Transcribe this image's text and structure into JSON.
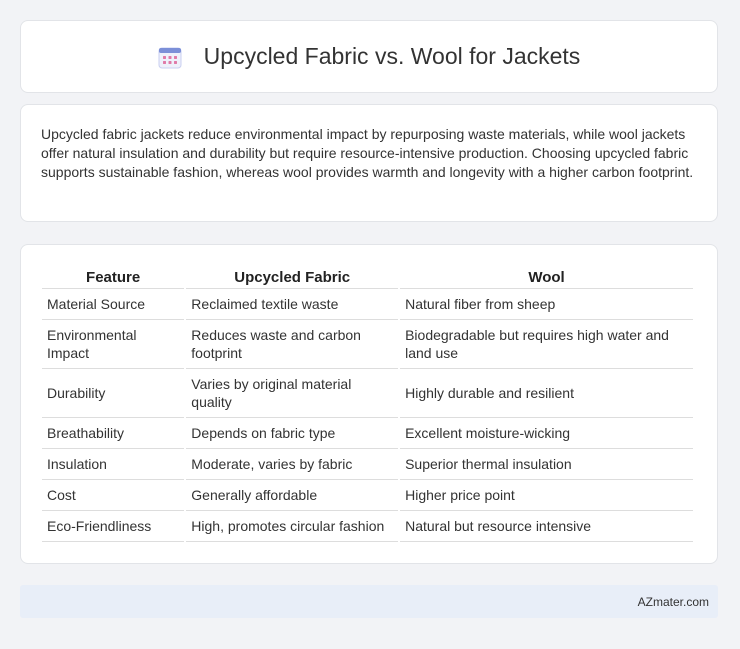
{
  "header": {
    "title": "Upcycled Fabric vs. Wool for Jackets",
    "icon": "calendar-icon",
    "accent_color": "#7b8fd8"
  },
  "summary": {
    "text": "Upcycled fabric jackets reduce environmental impact by repurposing waste materials, while wool jackets offer natural insulation and durability but require resource-intensive production. Choosing upcycled fabric supports sustainable fashion, whereas wool provides warmth and longevity with a higher carbon footprint."
  },
  "table": {
    "headers": [
      "Feature",
      "Upcycled Fabric",
      "Wool"
    ],
    "rows": [
      [
        "Material Source",
        "Reclaimed textile waste",
        "Natural fiber from sheep"
      ],
      [
        "Environmental Impact",
        "Reduces waste and carbon footprint",
        "Biodegradable but requires high water and land use"
      ],
      [
        "Durability",
        "Varies by original material quality",
        "Highly durable and resilient"
      ],
      [
        "Breathability",
        "Depends on fabric type",
        "Excellent moisture-wicking"
      ],
      [
        "Insulation",
        "Moderate, varies by fabric",
        "Superior thermal insulation"
      ],
      [
        "Cost",
        "Generally affordable",
        "Higher price point"
      ],
      [
        "Eco-Friendliness",
        "High, promotes circular fashion",
        "Natural but resource intensive"
      ]
    ]
  },
  "footer": {
    "brand": "AZmater.com"
  }
}
